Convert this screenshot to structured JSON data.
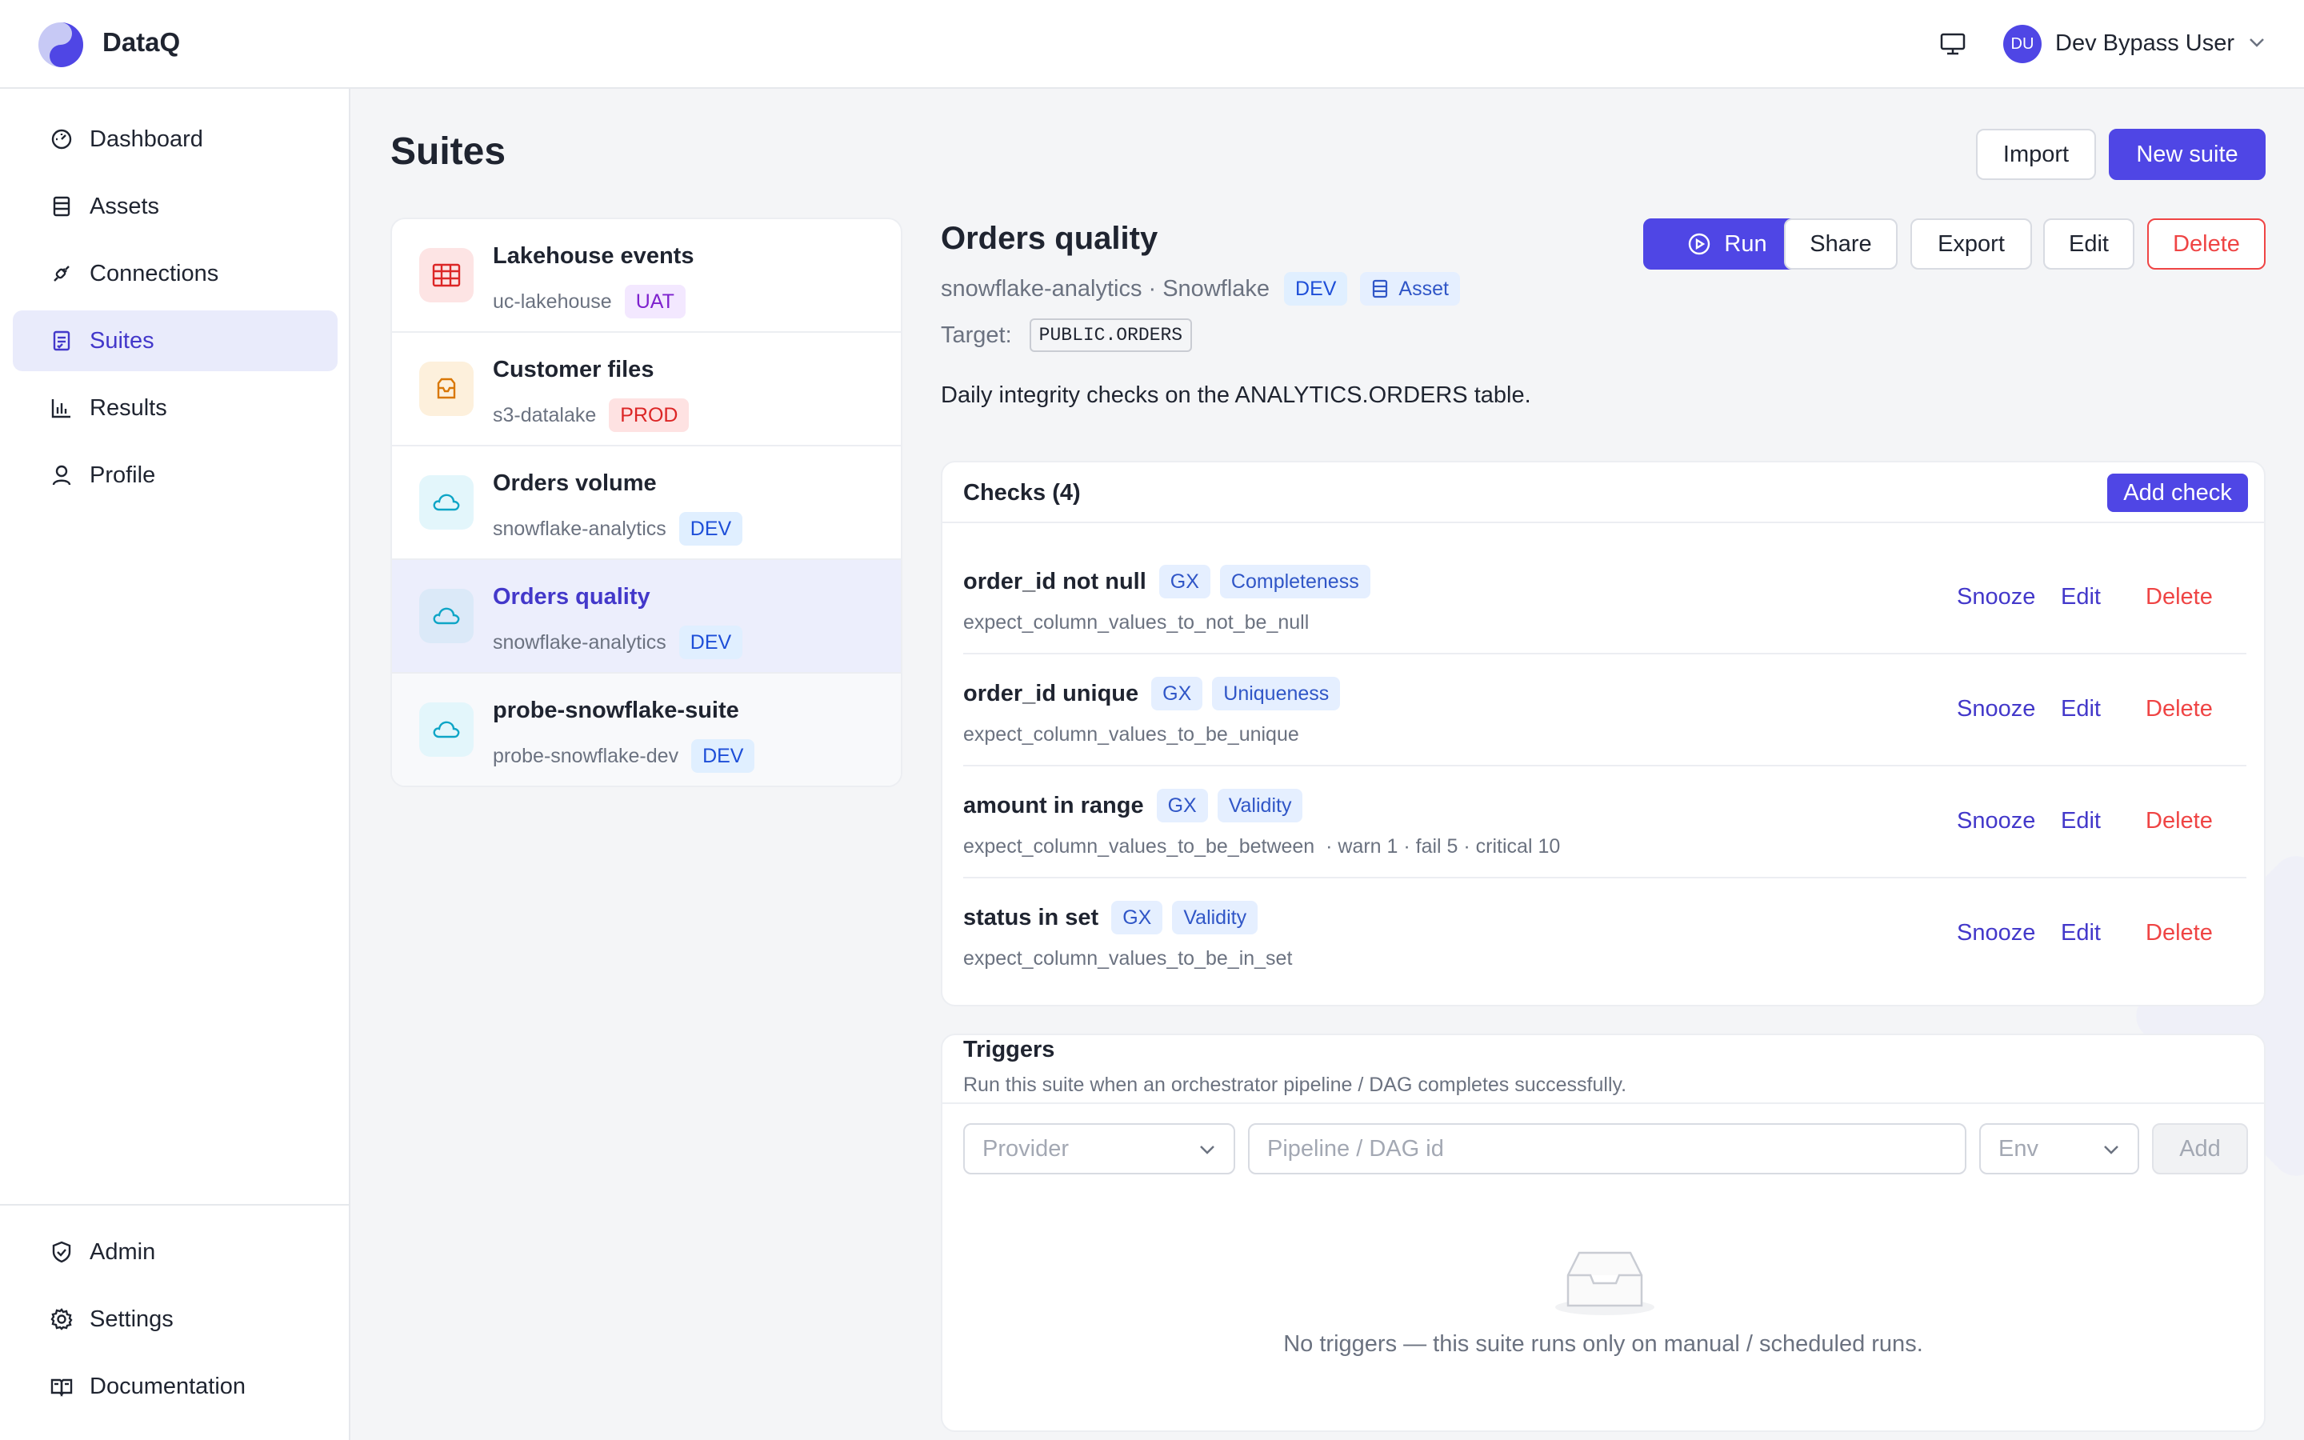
{
  "header": {
    "brand": "DataQ",
    "user": {
      "initials": "DU",
      "name": "Dev Bypass User"
    }
  },
  "sidebar": {
    "items": [
      {
        "label": "Dashboard",
        "icon": "gauge-icon"
      },
      {
        "label": "Assets",
        "icon": "table-icon"
      },
      {
        "label": "Connections",
        "icon": "plug-icon"
      },
      {
        "label": "Suites",
        "icon": "clipboard-check-icon",
        "active": true
      },
      {
        "label": "Results",
        "icon": "bar-chart-icon"
      },
      {
        "label": "Profile",
        "icon": "user-icon"
      }
    ],
    "bottom_items": [
      {
        "label": "Admin",
        "icon": "shield-check-icon"
      },
      {
        "label": "Settings",
        "icon": "gear-icon"
      },
      {
        "label": "Documentation",
        "icon": "book-icon"
      }
    ]
  },
  "page": {
    "title": "Suites",
    "import_label": "Import",
    "new_suite_label": "New suite"
  },
  "suites": [
    {
      "name": "Lakehouse events",
      "connection": "uc-lakehouse",
      "env": "UAT",
      "icon": "table-icon"
    },
    {
      "name": "Customer files",
      "connection": "s3-datalake",
      "env": "PROD",
      "icon": "inbox-icon"
    },
    {
      "name": "Orders volume",
      "connection": "snowflake-analytics",
      "env": "DEV",
      "icon": "cloud-icon"
    },
    {
      "name": "Orders quality",
      "connection": "snowflake-analytics",
      "env": "DEV",
      "icon": "cloud-icon",
      "active": true
    },
    {
      "name": "probe-snowflake-suite",
      "connection": "probe-snowflake-dev",
      "env": "DEV",
      "icon": "cloud-icon"
    }
  ],
  "detail": {
    "title": "Orders quality",
    "subtitle": "snowflake-analytics · Snowflake",
    "env": "DEV",
    "asset_label": "Asset",
    "target_label": "Target:",
    "target_value": "PUBLIC.ORDERS",
    "description": "Daily integrity checks on the ANALYTICS.ORDERS table.",
    "actions": {
      "run": "Run",
      "share": "Share",
      "export": "Export",
      "edit": "Edit",
      "delete": "Delete"
    }
  },
  "checks": {
    "title": "Checks (4)",
    "add_label": "Add check",
    "row_actions": {
      "snooze": "Snooze",
      "edit": "Edit",
      "delete": "Delete"
    },
    "items": [
      {
        "name": "order_id not null",
        "engine": "GX",
        "dimension": "Completeness",
        "expectation": "expect_column_values_to_not_be_null",
        "thresholds": ""
      },
      {
        "name": "order_id unique",
        "engine": "GX",
        "dimension": "Uniqueness",
        "expectation": "expect_column_values_to_be_unique",
        "thresholds": ""
      },
      {
        "name": "amount in range",
        "engine": "GX",
        "dimension": "Validity",
        "expectation": "expect_column_values_to_be_between",
        "thresholds": "· warn 1 · fail 5 · critical 10"
      },
      {
        "name": "status in set",
        "engine": "GX",
        "dimension": "Validity",
        "expectation": "expect_column_values_to_be_in_set",
        "thresholds": ""
      }
    ]
  },
  "triggers": {
    "title": "Triggers",
    "description": "Run this suite when an orchestrator pipeline / DAG completes successfully.",
    "provider_placeholder": "Provider",
    "pipeline_placeholder": "Pipeline / DAG id",
    "env_placeholder": "Env",
    "add_label": "Add",
    "empty_text": "No triggers — this suite runs only on manual / scheduled runs."
  },
  "colors": {
    "accent": "#4f46e5",
    "danger": "#ef4444",
    "active_bg": "#e9ebfb"
  }
}
